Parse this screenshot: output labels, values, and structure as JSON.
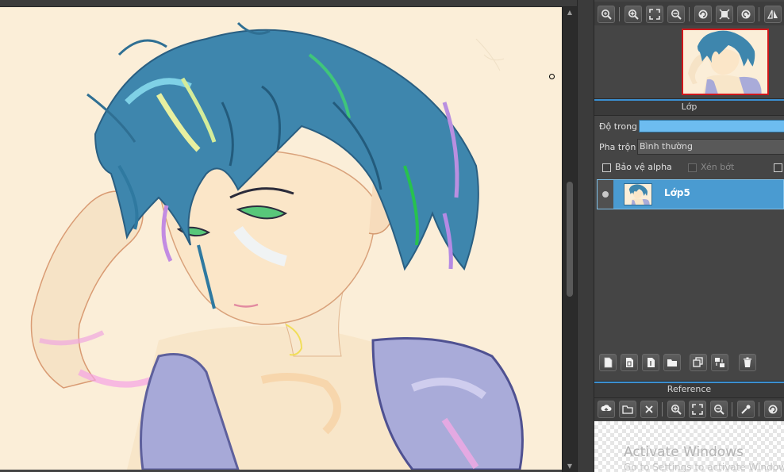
{
  "navigator_toolbar": {
    "buttons": [
      "zoom-fit-icon",
      "zoom-in-icon",
      "fit-screen-icon",
      "zoom-out-icon",
      "rotate-left-icon",
      "full-view-icon",
      "rotate-right-icon",
      "flip-icon"
    ]
  },
  "layer_panel": {
    "title": "Lớp",
    "opacity_label": "Độ trong",
    "opacity_fraction": 1.0,
    "blend_label": "Pha trộn",
    "blend_value": "Bình thường",
    "protect_alpha_label": "Bảo vệ alpha",
    "clipping_label": "Xén bớt",
    "layers": [
      {
        "name": "Lớp5",
        "visible": true,
        "selected": true
      }
    ],
    "tool_buttons": [
      "new-layer-icon",
      "new-vector-layer-icon",
      "new-halftone-layer-icon",
      "new-folder-icon",
      "duplicate-layer-icon",
      "merge-layer-icon",
      "delete-layer-icon"
    ]
  },
  "reference_panel": {
    "title": "Reference",
    "tool_buttons": [
      "upload-icon",
      "open-folder-icon",
      "close-icon",
      "zoom-in-icon",
      "fit-screen-icon",
      "zoom-out-icon",
      "eyedropper-icon",
      "rotate-icon"
    ]
  },
  "watermark": {
    "title": "Activate Windows",
    "subtitle": "Go to Settings to activate Windows."
  },
  "colors": {
    "panel_bg": "#454545",
    "selection": "#4a9bd1",
    "accent": "#3b8fd0",
    "navigator_frame": "#d0171b",
    "canvas_paper": "#fbeed8"
  }
}
